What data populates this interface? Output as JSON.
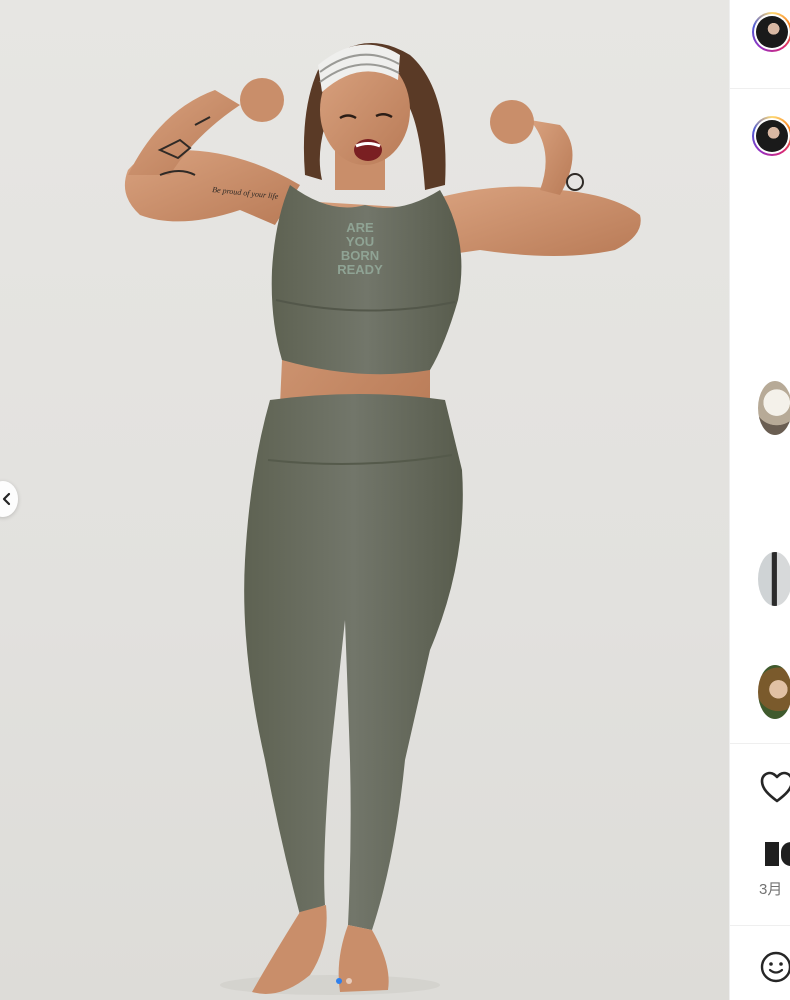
{
  "post": {
    "carousel": {
      "dots": 2,
      "active_index": 0
    },
    "photo": {
      "top_print_lines": [
        "ARE",
        "YOU",
        "BORN",
        "READY"
      ],
      "tattoo_text": "Be proud of your life"
    }
  },
  "sidebar": {
    "date_text": "3月"
  },
  "icons": {
    "prev": "chevron-left-icon",
    "like": "heart-icon",
    "emoji": "emoji-icon"
  },
  "colors": {
    "outfit": "#6b6e5d",
    "background": "#e4e3e0",
    "active_dot": "#2f80ed"
  }
}
